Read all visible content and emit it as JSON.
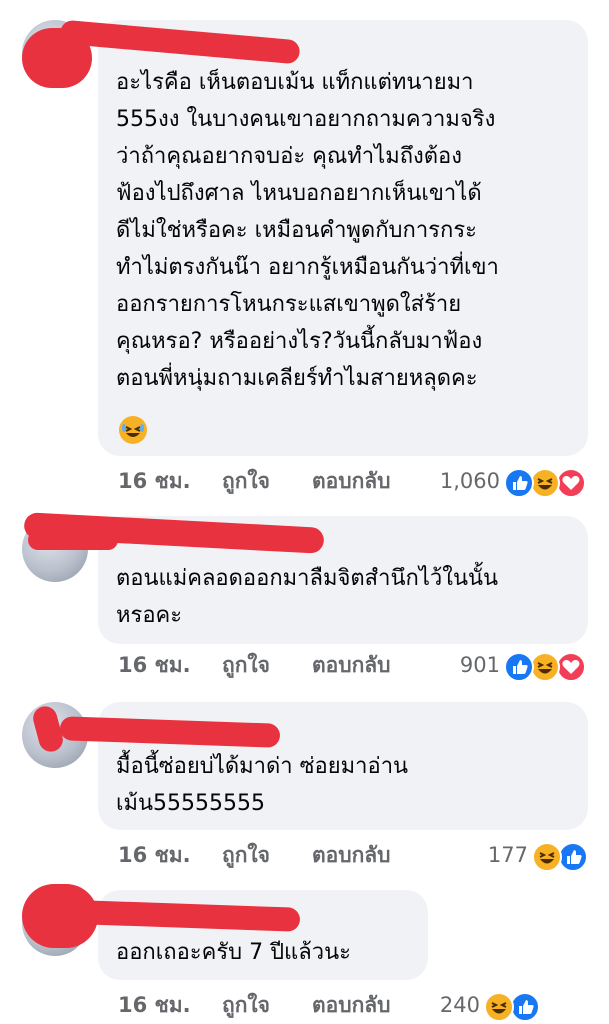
{
  "comments": [
    {
      "text": "อะไรคือ เห็นตอบเม้น แท็กแต่ทนายมา\n555งง ในบางคนเขาอยากถามความจริง\nว่าถ้าคุณอยากจบอ่ะ คุณทำไมถึงต้อง\nฟ้องไปถึงศาล ไหนบอกอยากเห็นเขาได้\nดีไม่ใช่หรือคะ เหมือนคำพูดกับการกระ\nทำไม่ตรงกันน๊า อยากรู้เหมือนกันว่าที่เขา\nออกรายการโหนกระแสเขาพูดใส่ร้าย\nคุณหรอ? หรืออย่างไร?วันนี้กลับมาฟ้อง\nตอนพี่หนุ่มถามเคลียร์ทำไมสายหลุดคะ",
      "trailing_emoji": "laughing-emoji",
      "time": "16 ชม.",
      "like_label": "ถูกใจ",
      "reply_label": "ตอบกลับ",
      "reaction_count": "1,060",
      "reactions": [
        "like",
        "haha",
        "love"
      ]
    },
    {
      "text": "ตอนแม่คลอดออกมาลืมจิตสำนึกไว้ในนั้น\nหรอคะ",
      "time": "16 ชม.",
      "like_label": "ถูกใจ",
      "reply_label": "ตอบกลับ",
      "reaction_count": "901",
      "reactions": [
        "like",
        "haha",
        "love"
      ]
    },
    {
      "text": "มื้อนี้ซ่อยบ่ได้มาด่า ซ่อยมาอ่าน\nเม้น55555555",
      "time": "16 ชม.",
      "like_label": "ถูกใจ",
      "reply_label": "ตอบกลับ",
      "reaction_count": "177",
      "reactions": [
        "haha",
        "like"
      ]
    },
    {
      "text": "ออกเถอะครับ  7 ปีแล้วนะ",
      "time": "16 ชม.",
      "like_label": "ถูกใจ",
      "reply_label": "ตอบกลับ",
      "reaction_count": "240",
      "reactions": [
        "haha",
        "like"
      ]
    }
  ],
  "colors": {
    "bubble": "#f0f2f5",
    "meta_text": "#65676b",
    "like": "#1877f2",
    "haha": "#f7b125",
    "love": "#f33e58",
    "redaction": "#e8323f"
  }
}
